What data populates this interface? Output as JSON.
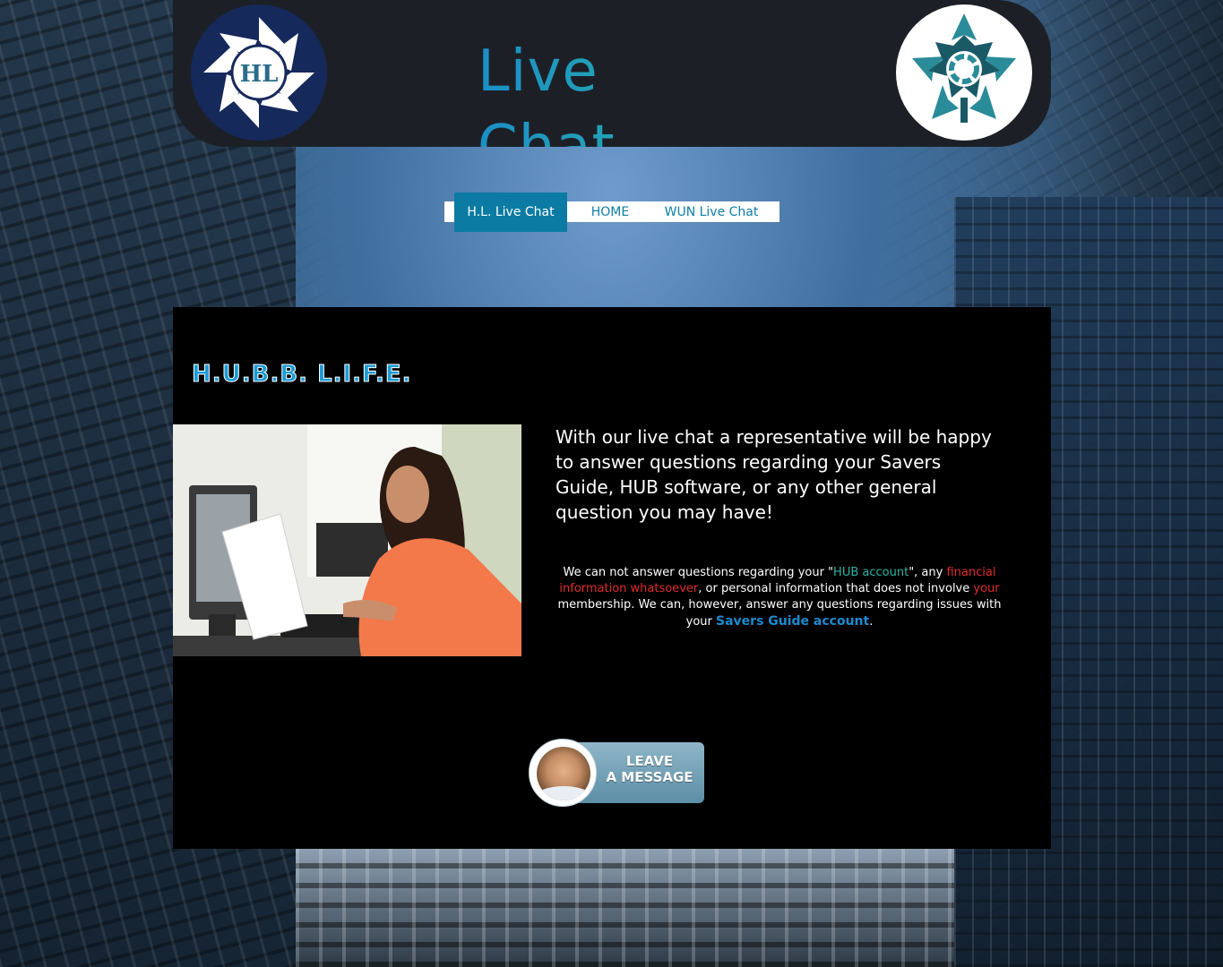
{
  "header": {
    "title": "Live Chat",
    "left_logo": {
      "text": "HL",
      "icon": "hl-pinwheel-logo-icon",
      "color": "#16295b"
    },
    "right_logo": {
      "icon": "maple-leaf-logo-icon",
      "color": "#2a8b99"
    }
  },
  "nav": {
    "items": [
      {
        "label": "H.L. Live Chat",
        "active": true
      },
      {
        "label": "HOME",
        "active": false
      },
      {
        "label": "WUN Live Chat",
        "active": false
      }
    ]
  },
  "main": {
    "brand": "H.U.B.B. L.I.F.E.",
    "photo": {
      "icon": "woman-at-computer-photo"
    },
    "intro": "With our live chat a representative will be happy to answer questions regarding your Savers Guide, HUB software, or any other general question you may have!",
    "notice": {
      "part1": "We can not answer questions regarding your \"",
      "hub_account": "HUB account",
      "part2": "\", any ",
      "financial": "financial information whatsoever",
      "part3": ", or personal information that does not involve ",
      "your": "your",
      "part4": " membership. We can, however, answer any questions regarding issues with your ",
      "savers": "Savers Guide account",
      "part5": "."
    },
    "leave_message": {
      "label_line1": "LEAVE",
      "label_line2": "A MESSAGE",
      "icon": "support-agent-avatar-icon"
    }
  },
  "colors": {
    "accent_blue": "#0b7ba3",
    "teal": "#2bb3a3",
    "red": "#e22b2b",
    "panel_bg": "#000000",
    "header_bg": "#1c2026"
  }
}
